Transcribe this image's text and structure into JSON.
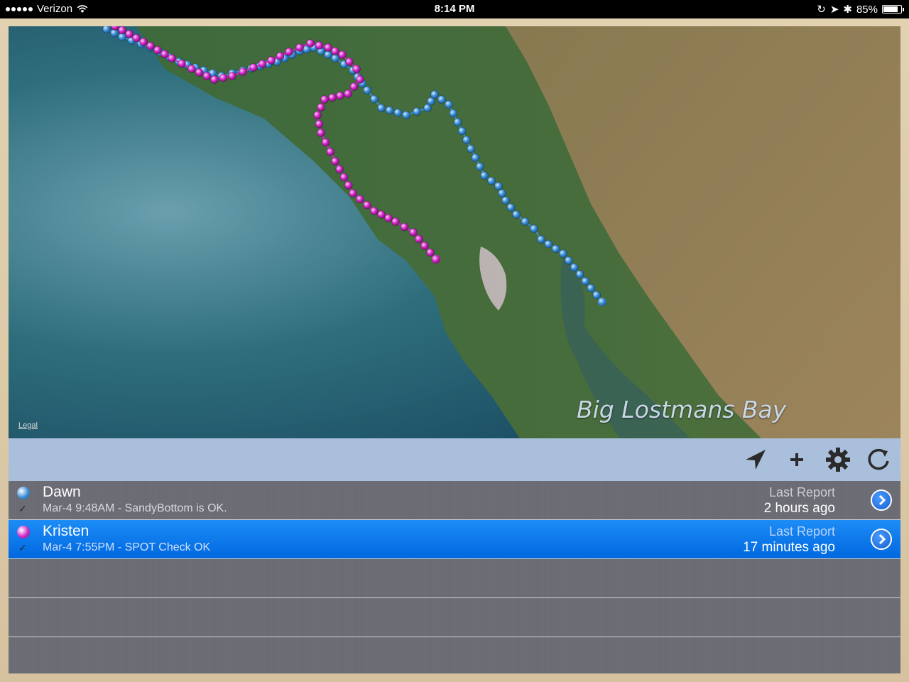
{
  "status_bar": {
    "carrier": "Verizon",
    "time": "8:14 PM",
    "battery": "85%",
    "battery_level": 0.85
  },
  "map": {
    "place_label": "Big Lostmans Bay",
    "legal_link": "Legal",
    "track_colors": {
      "dawn": "#3b8fd8",
      "kristen": "#d429c9"
    }
  },
  "toolbar": {
    "icons": [
      "location-arrow-icon",
      "add-icon",
      "gear-icon",
      "refresh-icon"
    ]
  },
  "trackers": [
    {
      "name": "Dawn",
      "detail": "Mar-4 9:48AM - SandyBottom is OK.",
      "last_report_label": "Last Report",
      "last_report_time": "2 hours ago",
      "color": "#3b8fd8",
      "selected": false
    },
    {
      "name": "Kristen",
      "detail": "Mar-4 7:55PM - SPOT Check OK",
      "last_report_label": "Last Report",
      "last_report_time": "17 minutes ago",
      "color": "#d429c9",
      "selected": true
    }
  ]
}
